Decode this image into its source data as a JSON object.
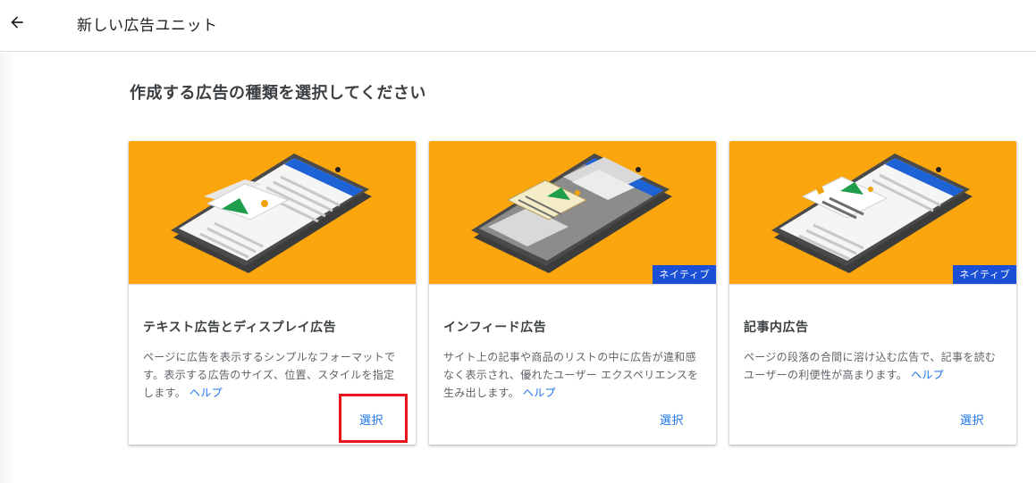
{
  "header": {
    "back_icon": "arrow-left-icon",
    "title": "新しい広告ユニット"
  },
  "main": {
    "heading": "作成する広告の種類を選択してください"
  },
  "cards": [
    {
      "title": "テキスト広告とディスプレイ広告",
      "description": "ページに広告を表示するシンプルなフォーマットです。表示する広告のサイズ、位置、スタイルを指定します。",
      "help": "ヘルプ",
      "select": "選択",
      "badge": ""
    },
    {
      "title": "インフィード広告",
      "description": "サイト上の記事や商品のリストの中に広告が違和感なく表示され、優れたユーザー エクスペリエンスを生み出します。",
      "help": "ヘルプ",
      "select": "選択",
      "badge": "ネイティブ"
    },
    {
      "title": "記事内広告",
      "description": "ページの段落の合間に溶け込む広告で、記事を読むユーザーの利便性が高まります。",
      "help": "ヘルプ",
      "select": "選択",
      "badge": "ネイティブ"
    }
  ],
  "colors": {
    "hero_background": "#fba60c",
    "badge_background": "#1a4fd6",
    "link": "#1a73e8",
    "highlight": "#e8141c"
  }
}
